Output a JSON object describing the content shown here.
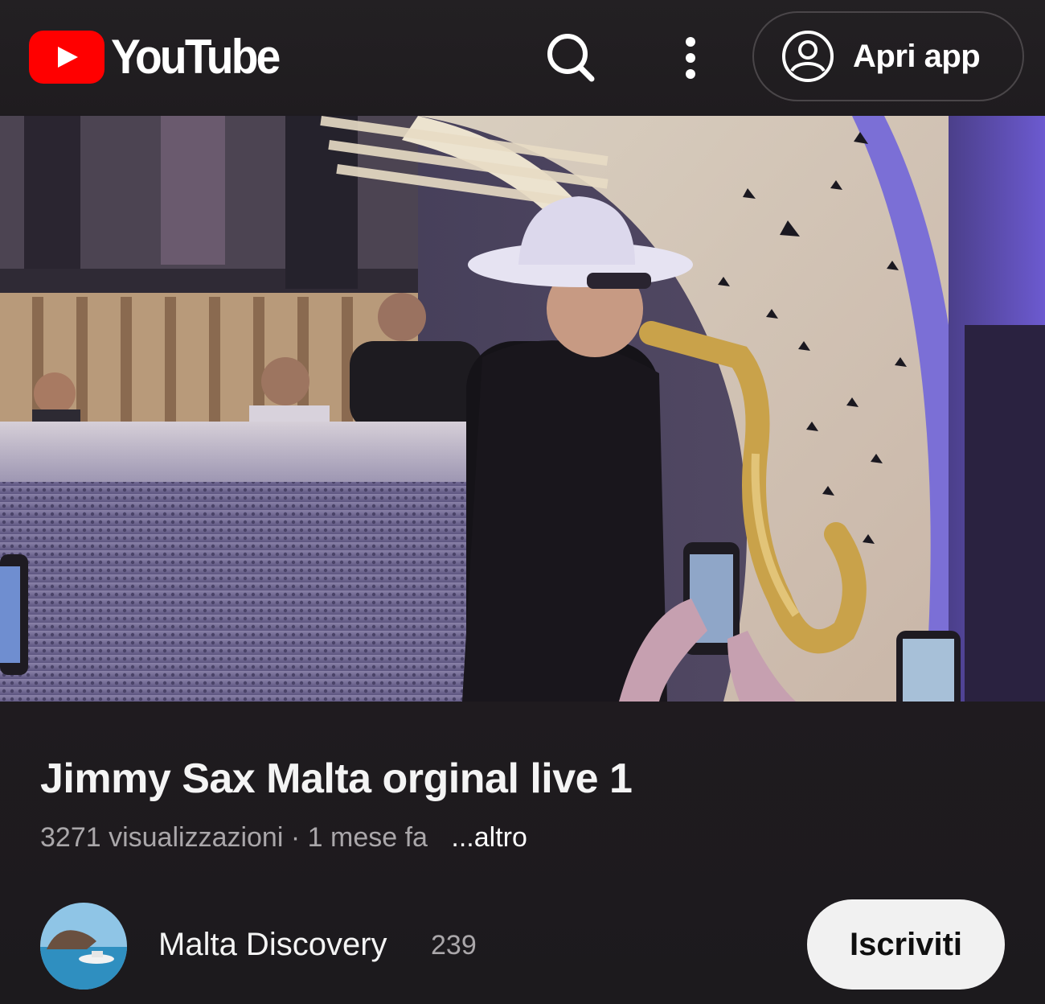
{
  "header": {
    "logo_text": "YouTube",
    "open_app_label": "Apri app"
  },
  "video": {
    "title": "Jimmy Sax Malta orginal live 1",
    "views": "3271 visualizzazioni",
    "separator": "·",
    "age": "1 mese fa",
    "more_label": "...altro"
  },
  "channel": {
    "name": "Malta Discovery",
    "subscriber_count": "239",
    "subscribe_label": "Iscriviti"
  },
  "icons": {
    "logo": "youtube-logo-icon",
    "search": "search-icon",
    "more": "more-vert-icon",
    "account": "account-circle-icon"
  },
  "colors": {
    "brand_red": "#ff0000",
    "background": "#1e1b1f",
    "secondary_text": "#aaa7aa"
  }
}
